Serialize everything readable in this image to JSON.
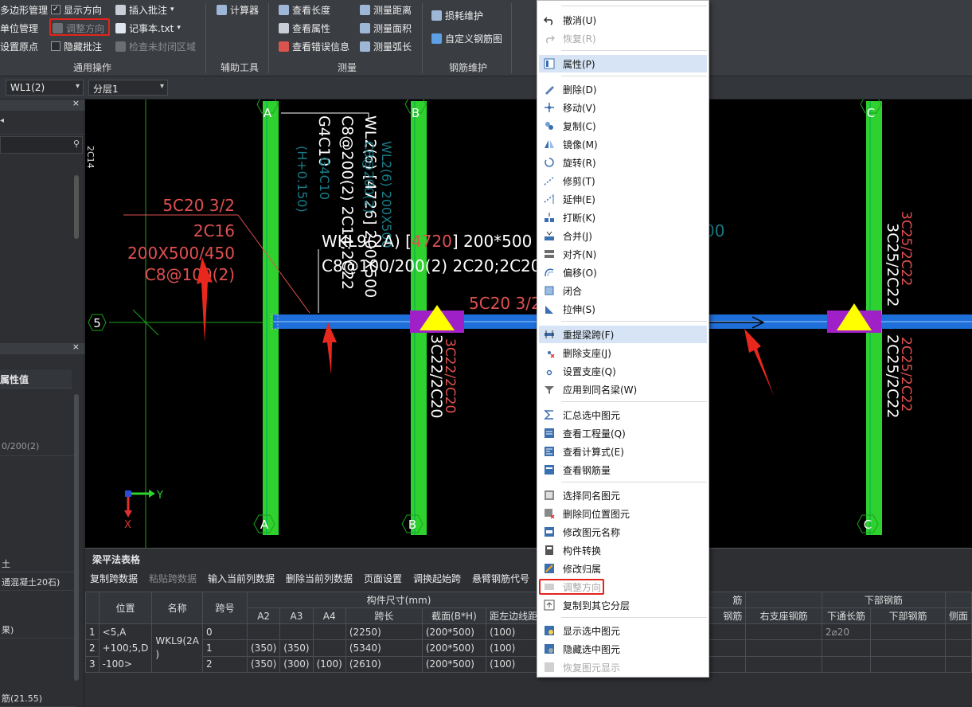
{
  "ribbon": {
    "common": {
      "polygon_mgmt": "多边形管理",
      "unit_mgmt": "单位管理",
      "set_origin": "设置原点",
      "show_direction": "显示方向",
      "adjust_direction": "调整方向",
      "hide_annotation": "隐藏批注",
      "insert_annotation": "插入批注",
      "notepad": "记事本.txt",
      "check_unclosed": "检查未封闭区域",
      "group": "通用操作"
    },
    "aux": {
      "calculator": "计算器",
      "group": "辅助工具"
    },
    "measure": {
      "view_length": "查看长度",
      "view_props": "查看属性",
      "view_errors": "查看错误信息",
      "measure_distance": "测量距离",
      "measure_area": "测量面积",
      "measure_arc": "测量弧长",
      "group": "测量"
    },
    "rebar": {
      "loss": "损耗维护",
      "custom_rebar": "自定义钢筋图",
      "group": "钢筋维护"
    }
  },
  "selbar": {
    "element": "WL1(2)",
    "layer": "分层1"
  },
  "left_panel": {
    "header_label": "属性值",
    "values": [
      "0/200(2)",
      "土",
      "通混凝土20石)",
      "果)",
      "筋(21.55)"
    ]
  },
  "canvas": {
    "axis_a": "A",
    "axis_b": "B",
    "axis_c": "C",
    "axis_5": "5",
    "wl2_line1": "WL2(6) [4726] 200X500",
    "wl2_line2": "C8@200(2) 2C14;2C22",
    "wl2_line3": "G4C10",
    "wl2_cyan1": "WL2(6) 200X500",
    "wl2_cyan2": "C8@200(2)",
    "wl2_cyan3": "G4C10",
    "wl2_cyan4": "(H+0.150)",
    "cyan_right": "00",
    "red_beam1": "5C20 3/2",
    "red_beam2": "2C16",
    "red_beam3": "200X500/450",
    "red_beam4": "C8@100(2)",
    "wkl9_line1_a": "WKL9(2A) [",
    "wkl9_line1_b": "4720",
    "wkl9_line1_c": "] 200*500",
    "wkl9_line2": "C8@100/200(2) 2C20;2C20",
    "top_rebar_right": "5C20 3/2",
    "support_b_white": "3C22/2C20",
    "support_b_red": "3C22/2C20",
    "support_c_white1": "3C25/2C22",
    "support_c_red1": "3C25/2C22",
    "support_c_white2": "2C25/2C22",
    "support_c_red2": "2C25/2C22",
    "left_vertical": "2C14",
    "ucs_x": "X",
    "ucs_y": "Y"
  },
  "table": {
    "title": "梁平法表格",
    "toolbar": [
      "复制跨数据",
      "粘贴跨数据",
      "输入当前列数据",
      "删除当前列数据",
      "页面设置",
      "调换起始跨",
      "悬臂钢筋代号"
    ],
    "toolbar_disabled": [
      false,
      true,
      false,
      false,
      false,
      false,
      false
    ],
    "headers": {
      "position": "位置",
      "name": "名称",
      "span": "跨号",
      "size_group": "构件尺寸(mm)",
      "a2": "A2",
      "a3": "A3",
      "a4": "A4",
      "span_len": "跨长",
      "section": "截面(B*H)",
      "edge_dist": "距左边线距离",
      "rebar_group": "筋",
      "rebar_col": "钢筋",
      "right_support": "右支座钢筋",
      "bottom_group": "下部钢筋",
      "bottom_through": "下通长筋",
      "bottom_rebar": "下部钢筋",
      "side": "侧面"
    },
    "position_value": "<5,A\n+100;5,D\n-100>",
    "name_value": "WKL9(2A\n)",
    "row_numbers": [
      "1",
      "2",
      "3"
    ],
    "rows": [
      {
        "span": "0",
        "a2": "",
        "a3": "",
        "a4": "",
        "len": "(2250)",
        "sec": "(200*500)",
        "dist": "(100)",
        "through": "2⌀20"
      },
      {
        "span": "1",
        "a2": "(350)",
        "a3": "(350)",
        "a4": "",
        "len": "(5340)",
        "sec": "(200*500)",
        "dist": "(100)",
        "through": ""
      },
      {
        "span": "2",
        "a2": "(350)",
        "a3": "(300)",
        "a4": "(100)",
        "len": "(2610)",
        "sec": "(200*500)",
        "dist": "(100)",
        "through": ""
      }
    ]
  },
  "context_menu": {
    "undo": "撤消(U)",
    "redo": "恢复(R)",
    "properties": "属性(P)",
    "delete": "删除(D)",
    "move": "移动(V)",
    "copy": "复制(C)",
    "mirror": "镜像(M)",
    "rotate": "旋转(R)",
    "trim": "修剪(T)",
    "extend": "延伸(E)",
    "break": "打断(K)",
    "merge": "合并(J)",
    "align": "对齐(N)",
    "offset": "偏移(O)",
    "close": "闭合",
    "stretch": "拉伸(S)",
    "re_extract_span": "重提梁跨(F)",
    "delete_support": "删除支座(J)",
    "set_support": "设置支座(Q)",
    "apply_same_name": "应用到同名梁(W)",
    "summarize_selected": "汇总选中图元",
    "view_quantity": "查看工程量(Q)",
    "view_formula": "查看计算式(E)",
    "view_rebar": "查看钢筋量",
    "select_same_name": "选择同名图元",
    "delete_same_pos": "删除同位置图元",
    "rename": "修改图元名称",
    "convert": "构件转换",
    "change_owner": "修改归属",
    "adjust_direction": "调整方向",
    "copy_to_layer": "复制到其它分层",
    "show_selected": "显示选中图元",
    "hide_selected": "隐藏选中图元",
    "restore_display": "恢复图元显示"
  }
}
